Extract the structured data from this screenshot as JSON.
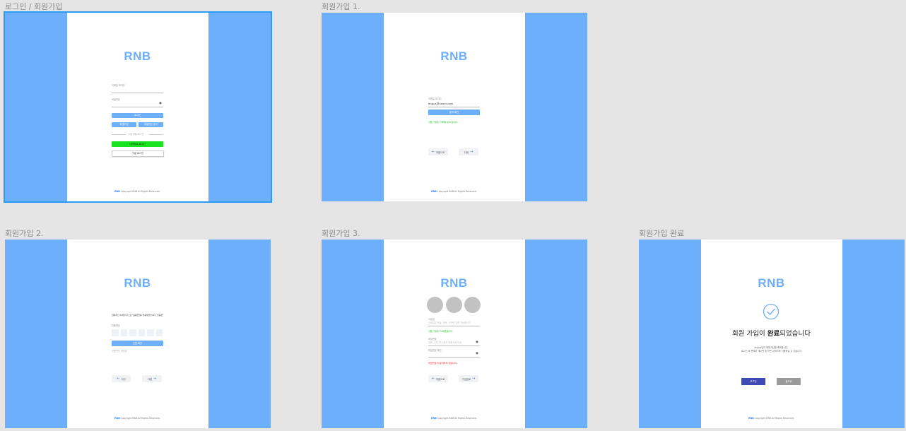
{
  "frames": {
    "login": {
      "label": "로그인 / 회원가입",
      "logo": "RNB",
      "email_label": "이메일 아이디",
      "password_label": "비밀번호",
      "login_button": "로그인",
      "signup_button": "회원가입",
      "find_password_button": "비밀번호 찾기",
      "sns_divider": "소셜 계정 로그인",
      "naver_button": "네이버로 로그인",
      "google_button": "구글 로그인",
      "footer_brand": "RNB",
      "footer_text": "Copyright RNB All Rights Reserved."
    },
    "signup1": {
      "label": "회원가입 1.",
      "logo": "RNB",
      "email_label": "이메일 아이디",
      "email_value": "dngus@naver.com",
      "check_button": "중복 확인",
      "ok_message": "사용 가능한 이메일 주소입니다.",
      "prev_button": "처음으로",
      "next_button": "다음",
      "footer_brand": "RNB",
      "footer_text": "Copyright RNB All Rights Reserved."
    },
    "signup2": {
      "label": "회원가입 2.",
      "logo": "RNB",
      "instruction": "입력하신 이메일 주소로 인증번호를 발송하였습니다. 인증번호를 입력하세요",
      "code_label": "인증번호",
      "confirm_button": "인증 확인",
      "resend_text": "인증번호 재전송",
      "prev_button": "이전",
      "next_button": "다음",
      "footer_brand": "RNB",
      "footer_text": "Copyright RNB All Rights Reserved."
    },
    "signup3": {
      "label": "회원가입 3.",
      "logo": "RNB",
      "nickname_label": "닉네임",
      "nickname_placeholder": "닉네임은 한글, 영문, 숫자만 입력 가능합니다",
      "nickname_ok": "사용 가능한 닉네임입니다.",
      "password_label": "비밀번호",
      "password_placeholder": "영문, 숫자, 특수문자 포함 8자 이상",
      "password_confirm_label": "비밀번호 확인",
      "password_error": "비밀번호가 일치하지 않습니다.",
      "prev_button": "처음으로",
      "next_button": "가입완료",
      "footer_brand": "RNB",
      "footer_text": "Copyright RNB All Rights Reserved."
    },
    "complete": {
      "label": "회원가입 완료",
      "logo": "RNB",
      "title_pre": "회원 가입이 ",
      "title_bold": "완료",
      "title_post": "되었습니다",
      "line1": "dngus님의 회원가입을 축하합니다.",
      "line2": "로그인 후 판매자 게시판 등 모든 서비스를 이용하실 수 있습니다",
      "login_button": "로그인",
      "close_button": "홈으로",
      "footer_brand": "RNB",
      "footer_text": "Copyright RNB All Rights Reserved."
    }
  },
  "colors": {
    "brand_blue": "#6eaffb",
    "canvas_bg": "#e5e5e5",
    "selection": "#2a9cf5",
    "success": "#19c81e",
    "error": "#ee2222",
    "naver_green": "#19e31e",
    "login_navy": "#3d4ab5"
  }
}
